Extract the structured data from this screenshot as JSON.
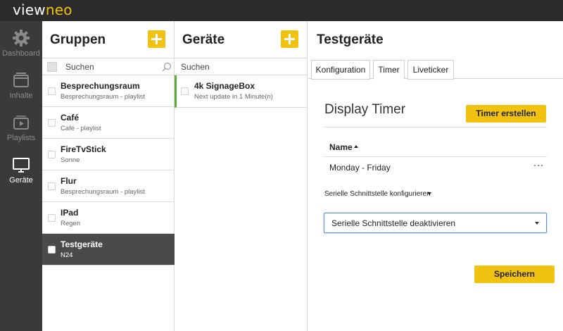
{
  "app": {
    "logo_part1": "view",
    "logo_part2": "neo"
  },
  "nav": {
    "items": [
      {
        "label": "Dashboard",
        "icon": "gear-icon"
      },
      {
        "label": "Inhalte",
        "icon": "folder-icon"
      },
      {
        "label": "Playlists",
        "icon": "playlist-icon"
      },
      {
        "label": "Geräte",
        "icon": "monitor-icon",
        "active": true
      }
    ]
  },
  "groups": {
    "title": "Gruppen",
    "search_placeholder": "Suchen",
    "items": [
      {
        "name": "Besprechungsraum",
        "sub": "Besprechungsraum - playlist"
      },
      {
        "name": "Café",
        "sub": "Café - playlist"
      },
      {
        "name": "FireTvStick",
        "sub": "Sonne"
      },
      {
        "name": "Flur",
        "sub": "Besprechungsraum - playlist"
      },
      {
        "name": "IPad",
        "sub": "Regen"
      },
      {
        "name": "Testgeräte",
        "sub": "N24",
        "active": true
      }
    ]
  },
  "devices": {
    "title": "Geräte",
    "search_placeholder": "Suchen",
    "items": [
      {
        "name": "4k SignageBox",
        "sub": "Next update in 1 Minute(n)",
        "status_color": "#5cae3a"
      }
    ]
  },
  "detail": {
    "title": "Testgeräte",
    "tabs": [
      {
        "label": "Konfiguration"
      },
      {
        "label": "Timer",
        "active": true
      },
      {
        "label": "Liveticker"
      }
    ],
    "timer": {
      "heading": "Display Timer",
      "create_button": "Timer erstellen",
      "table_header": "Name",
      "rows": [
        {
          "name": "Monday - Friday"
        }
      ],
      "serial_label": "Serielle Schnittstelle konfigurieren",
      "serial_select_value": "Serielle Schnittstelle deaktivieren",
      "save_button": "Speichern"
    }
  },
  "colors": {
    "accent": "#f2c211",
    "topbar": "#2b2b2b",
    "sidebar": "#3a3a3a",
    "selected_row": "#4a4a4a",
    "device_online": "#5cae3a"
  }
}
